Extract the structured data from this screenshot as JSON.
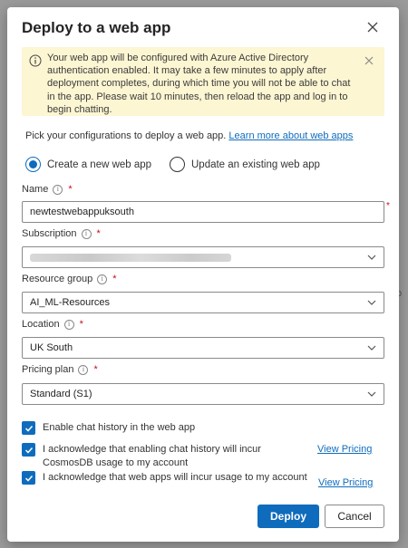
{
  "background": {
    "fragment_text": "p"
  },
  "dialog": {
    "title": "Deploy to a web app",
    "close_icon": "close-icon",
    "banner": {
      "icon": "info-icon",
      "message": "Your web app will be configured with Azure Active Directory authentication enabled. It may take a few minutes to apply after deployment completes, during which time you will not be able to chat in the app. Please wait 10 minutes, then reload the app and log in to begin chatting.",
      "close_icon": "close-icon"
    },
    "intro": {
      "text": "Pick your configurations to deploy a web app.",
      "link": "Learn more about web apps"
    },
    "radios": [
      {
        "label": "Create a new web app",
        "checked": true
      },
      {
        "label": "Update an existing web app",
        "checked": false
      }
    ],
    "fields": {
      "name": {
        "label": "Name",
        "required": "*",
        "value": "newtestwebappuksouth",
        "outer_required": "*"
      },
      "subscription": {
        "label": "Subscription",
        "required": "*",
        "value": ""
      },
      "resource_group": {
        "label": "Resource group",
        "required": "*",
        "value": "AI_ML-Resources"
      },
      "location": {
        "label": "Location",
        "required": "*",
        "value": "UK South"
      },
      "pricing_plan": {
        "label": "Pricing plan",
        "required": "*",
        "value": "Standard (S1)"
      }
    },
    "info_glyph": "i",
    "checkboxes": [
      {
        "label": "Enable chat history in the web app",
        "checked": true
      },
      {
        "label": "I acknowledge that enabling chat history will incur CosmosDB usage to my account",
        "checked": true,
        "link": "View Pricing"
      },
      {
        "label": "I acknowledge that web apps will incur usage to my account",
        "checked": true,
        "link": "View Pricing"
      }
    ],
    "buttons": {
      "deploy": "Deploy",
      "cancel": "Cancel"
    },
    "colors": {
      "accent": "#0f6cbd",
      "banner_bg": "#fdf6d3",
      "required": "#c50f1f"
    }
  }
}
